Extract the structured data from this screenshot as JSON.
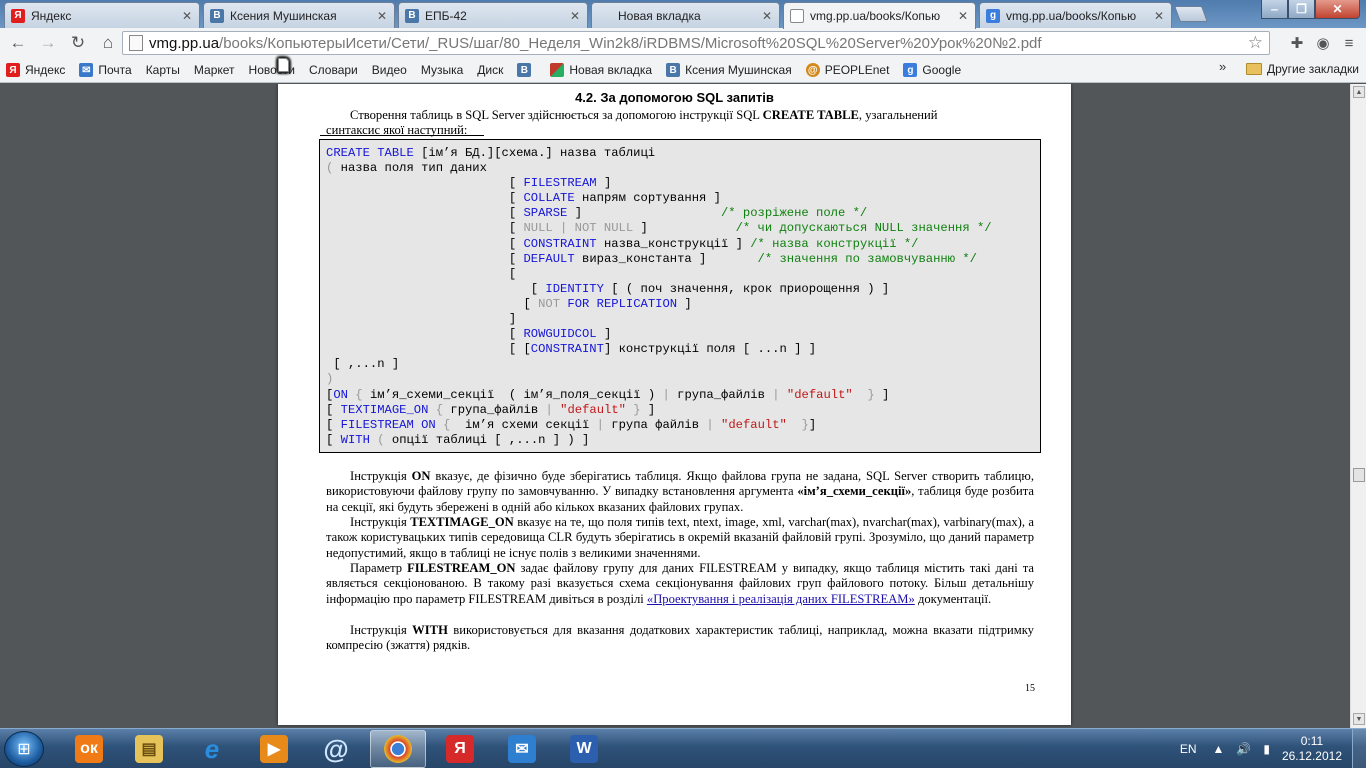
{
  "browser": {
    "tabs": [
      {
        "title": "Яндекс",
        "icon": "yandex-icon",
        "color": "#e01e1e",
        "glyph": "Я",
        "active": false
      },
      {
        "title": "Ксения Мушинская",
        "icon": "vk-icon",
        "color": "#4a76a8",
        "glyph": "В",
        "active": false
      },
      {
        "title": "ЕПБ-42",
        "icon": "vk-icon",
        "color": "#4a76a8",
        "glyph": "В",
        "active": false
      },
      {
        "title": "Новая вкладка",
        "icon": "",
        "color": "",
        "glyph": "",
        "active": false
      },
      {
        "title": "vmg.pp.ua/books/Копью",
        "icon": "page-icon",
        "color": "",
        "glyph": "",
        "active": true
      },
      {
        "title": "vmg.pp.ua/books/Копью",
        "icon": "google-icon",
        "color": "#3b7ddd",
        "glyph": "g",
        "active": false
      }
    ],
    "url_host": "vmg.pp.ua",
    "url_path": "/books/КопьютерыИсети/Сети/_RUS/шаг/80_Неделя_Win2k8/iRDBMS/Microsoft%20SQL%20Server%20Урок%20№2.pdf",
    "bookmarks": [
      {
        "label": "Яндекс",
        "icon": "yandex-icon",
        "color": "#e01e1e",
        "glyph": "Я"
      },
      {
        "label": "Почта",
        "icon": "mail-icon",
        "color": "#3a78c9",
        "glyph": "✉"
      },
      {
        "label": "Карты",
        "icon": "page-icon",
        "color": "",
        "glyph": ""
      },
      {
        "label": "Маркет",
        "icon": "page-icon",
        "color": "",
        "glyph": ""
      },
      {
        "label": "Новости",
        "icon": "page-icon",
        "color": "",
        "glyph": ""
      },
      {
        "label": "Словари",
        "icon": "page-icon",
        "color": "",
        "glyph": ""
      },
      {
        "label": "Видео",
        "icon": "page-icon",
        "color": "",
        "glyph": ""
      },
      {
        "label": "Музыка",
        "icon": "page-icon",
        "color": "",
        "glyph": ""
      },
      {
        "label": "Диск",
        "icon": "page-icon",
        "color": "",
        "glyph": ""
      },
      {
        "label": "",
        "icon": "vk-icon",
        "color": "#4a76a8",
        "glyph": "В"
      },
      {
        "label": "Новая вкладка",
        "icon": "colorful-app-icon",
        "color": "#c0392b",
        "glyph": "■"
      },
      {
        "label": "Ксения Мушинская",
        "icon": "vk-icon",
        "color": "#4a76a8",
        "glyph": "В"
      },
      {
        "label": "PEOPLEnet",
        "icon": "peoplenet-icon",
        "color": "#d48a1a",
        "glyph": "@"
      },
      {
        "label": "Google",
        "icon": "google-icon",
        "color": "#3b7ddd",
        "glyph": "g"
      }
    ],
    "bookmarks_more": "»",
    "other_bookmarks": "Другие закладки"
  },
  "document": {
    "heading": "4.2. За допомогою SQL запитів",
    "intro_line1_a": "Створення таблиць в SQL Server здійснюється за допомогою інструкції SQL ",
    "intro_line1_b": "CREATE TABLE",
    "intro_line1_c": ", узагальнений",
    "intro_line2": "синтаксис якої наступний:",
    "code": {
      "l1_kw": "CREATE TABLE",
      "l1_rest": " [ім’я БД.][схема.] назва таблиці",
      "l2_br": "(",
      "l2_rest": " назва поля тип даних",
      "l3_kw": "FILESTREAM",
      "l4_kw": "COLLATE",
      "l4_rest": " напрям сортування ]",
      "l5_kw": "SPARSE",
      "l5_cm": "/* розріжене поле */",
      "l6_null": "NULL | NOT NULL",
      "l6_cm": "/* чи допускаються NULL значення */",
      "l7_kw": "CONSTRAINT",
      "l7_rest": " назва_конструкції ]",
      "l7_cm": "/* назва конструкції */",
      "l8_kw": "DEFAULT",
      "l8_rest": " вираз_константа ]",
      "l8_cm": "/* значення по замовчуванню */",
      "l10_kw": "IDENTITY",
      "l10_rest": " [ ( поч значення, крок приорощення ) ]",
      "l11_not": "NOT",
      "l11_kw": "FOR REPLICATION",
      "l13_kw": "ROWGUIDCOL",
      "l14_kw": "CONSTRAINT",
      "l14_rest": "] конструкції поля [ ...n ] ]",
      "l15": " [ ,...n ]",
      "l16": ")",
      "l17_kw": "ON",
      "l17_a": " ім’я_схеми_секції  ( ім’я_поля_секції ) ",
      "l17_b": " група_файлів ",
      "l17_st": "\"default\"",
      "l18_kw": "TEXTIMAGE_ON",
      "l18_a": " група_файлів ",
      "l18_st": "\"default\"",
      "l19_kw": "FILESTREAM ON",
      "l19_a": "  ім’я схеми секції ",
      "l19_b": " група файлів ",
      "l19_st": "\"default\"",
      "l20_kw": "WITH",
      "l20_a": " опції таблиці [ ,...n ] ) ]"
    },
    "p1_a": "Інструкція ",
    "p1_b": "ON",
    "p1_c": " вказує, де фізично буде зберігатись таблиця. Якщо файлова група не задана, SQL Server створить таблицю, використовуючи файлову групу по замовчуванню. У випадку встановлення аргумента ",
    "p1_d": "«ім’я_схеми_секції»",
    "p1_e": ", таблиця буде розбита на секції, які будуть збережені в одній або кількох вказаних файлових групах.",
    "p2_a": "Інструкція ",
    "p2_b": "TEXTIMAGE_ON",
    "p2_c": " вказує на те, що поля типів text, ntext, image, xml, varchar(max), nvarchar(max), varbinary(max), а також користувацьких типів середовища CLR будуть зберігатись в окремій вказаній файловій групі. Зрозуміло, що даний параметр недопустимий, якщо в таблиці не існує полів з великими значеннями.",
    "p3_a": "Параметр ",
    "p3_b": "FILESTREAM_ON",
    "p3_c": " задає файлову групу для даних FILESTREAM у випадку, якщо таблиця містить такі дані та являється секціонованою. В такому разі вказується схема секціонування файлових груп файлового потоку. Більш детальнішу інформацію про параметр FILESTREAM дивіться в розділі ",
    "p3_link": "«Проектування і реалізація даних FILESTREAM»",
    "p3_d": " документації.",
    "p4_a": "Інструкція ",
    "p4_b": "WITH",
    "p4_c": " використовується для вказання додаткових характеристик таблиці, наприклад, можна вказати підтримку компресію (зжаття) рядків.",
    "page_number": "15"
  },
  "taskbar": {
    "apps": [
      {
        "icon": "odnoklassniki-icon",
        "color": "#f07a16",
        "glyph": "ок",
        "active": false
      },
      {
        "icon": "file-explorer-icon",
        "color": "#e6c25a",
        "glyph": "▤",
        "active": false
      },
      {
        "icon": "internet-explorer-icon",
        "color": "#2a8ee0",
        "glyph": "e",
        "active": false
      },
      {
        "icon": "media-player-icon",
        "color": "#e88a1a",
        "glyph": "▶",
        "active": false
      },
      {
        "icon": "qip-icon",
        "color": "#1c6fc4",
        "glyph": "@",
        "active": false
      },
      {
        "icon": "chrome-icon",
        "color": "#d9442b",
        "glyph": "◉",
        "active": true
      },
      {
        "icon": "yandex-browser-icon",
        "color": "#d62a2a",
        "glyph": "Я",
        "active": false
      },
      {
        "icon": "mail-agent-icon",
        "color": "#2f7fd1",
        "glyph": "✉",
        "active": false
      },
      {
        "icon": "word-icon",
        "color": "#2c5fad",
        "glyph": "W",
        "active": false
      }
    ],
    "language": "EN",
    "time": "0:11",
    "date": "26.12.2012"
  }
}
